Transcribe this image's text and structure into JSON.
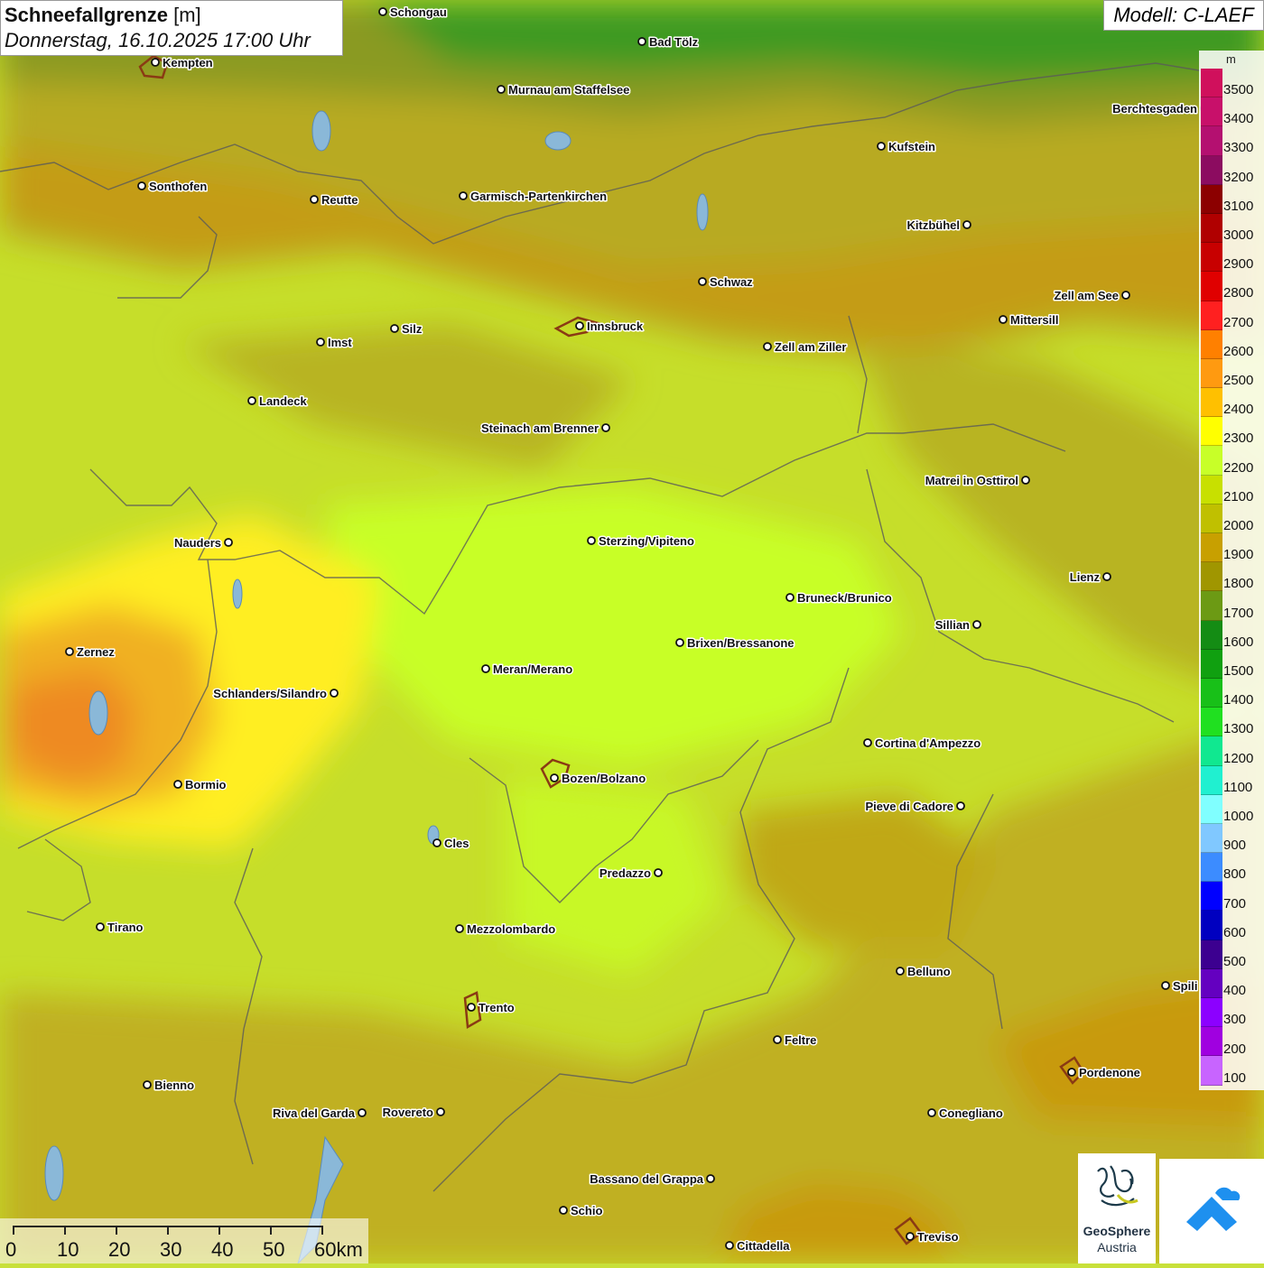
{
  "title": {
    "main": "Schneefallgrenze",
    "unit": "[m]",
    "date": "Donnerstag, 16.10.2025 17:00 Uhr"
  },
  "model": "Modell: C-LAEF",
  "legend": {
    "unit": "m",
    "labels": [
      "3500",
      "3400",
      "3300",
      "3200",
      "3100",
      "3000",
      "2900",
      "2800",
      "2700",
      "2600",
      "2500",
      "2400",
      "2300",
      "2200",
      "2100",
      "2000",
      "1900",
      "1800",
      "1700",
      "1600",
      "1500",
      "1400",
      "1300",
      "1200",
      "1100",
      "1000",
      "900",
      "800",
      "700",
      "600",
      "500",
      "400",
      "300",
      "200",
      "100"
    ],
    "colors": [
      "#d0105c",
      "#c8106a",
      "#b41070",
      "#8c0c60",
      "#8c0000",
      "#b00000",
      "#c80000",
      "#e00000",
      "#ff2020",
      "#ff8000",
      "#ff9a10",
      "#ffc000",
      "#ffff00",
      "#c8ff28",
      "#c8e000",
      "#c0c000",
      "#c8a000",
      "#a09600",
      "#6c9a14",
      "#148c14",
      "#10a010",
      "#18c018",
      "#20e020",
      "#10e890",
      "#20f0d0",
      "#80ffff",
      "#80c8ff",
      "#3c8cff",
      "#0000ff",
      "#0000c0",
      "#3c0090",
      "#6400c0",
      "#8c00ff",
      "#a000e0",
      "#c864ff"
    ]
  },
  "scale": {
    "labels": [
      "0",
      "10",
      "20",
      "30",
      "40",
      "50",
      "60km"
    ]
  },
  "logo": {
    "name": "GeoSphere",
    "sub": "Austria"
  },
  "cities": [
    {
      "name": "Schongau",
      "side": "right"
    },
    {
      "name": "Bad Tölz",
      "side": "right"
    },
    {
      "name": "Kempten",
      "side": "right"
    },
    {
      "name": "Murnau am Staffelsee",
      "side": "right"
    },
    {
      "name": "Berchtesgaden",
      "side": "left"
    },
    {
      "name": "Kufstein",
      "side": "right"
    },
    {
      "name": "Sonthofen",
      "side": "right"
    },
    {
      "name": "Reutte",
      "side": "right"
    },
    {
      "name": "Garmisch-Partenkirchen",
      "side": "right"
    },
    {
      "name": "Kitzbühel",
      "side": "left"
    },
    {
      "name": "Schwaz",
      "side": "right"
    },
    {
      "name": "Zell am See",
      "side": "left"
    },
    {
      "name": "Mittersill",
      "side": "right"
    },
    {
      "name": "Innsbruck",
      "side": "right"
    },
    {
      "name": "Imst",
      "side": "right"
    },
    {
      "name": "Silz",
      "side": "right"
    },
    {
      "name": "Zell am Ziller",
      "side": "right"
    },
    {
      "name": "Landeck",
      "side": "right"
    },
    {
      "name": "Steinach am Brenner",
      "side": "left"
    },
    {
      "name": "Matrei in Osttirol",
      "side": "left"
    },
    {
      "name": "Nauders",
      "side": "left"
    },
    {
      "name": "Sterzing/Vipiteno",
      "side": "right"
    },
    {
      "name": "Lienz",
      "side": "left"
    },
    {
      "name": "Bruneck/Brunico",
      "side": "right"
    },
    {
      "name": "Sillian",
      "side": "left"
    },
    {
      "name": "Zernez",
      "side": "right"
    },
    {
      "name": "Brixen/Bressanone",
      "side": "right"
    },
    {
      "name": "Meran/Merano",
      "side": "right"
    },
    {
      "name": "Schlanders/Silandro",
      "side": "left"
    },
    {
      "name": "Cortina d'Ampezzo",
      "side": "right"
    },
    {
      "name": "Bozen/Bolzano",
      "side": "right"
    },
    {
      "name": "Bormio",
      "side": "right"
    },
    {
      "name": "Pieve di Cadore",
      "side": "left"
    },
    {
      "name": "Cles",
      "side": "right"
    },
    {
      "name": "Predazzo",
      "side": "left"
    },
    {
      "name": "Tirano",
      "side": "right"
    },
    {
      "name": "Mezzolombardo",
      "side": "right"
    },
    {
      "name": "Belluno",
      "side": "right"
    },
    {
      "name": "Spili",
      "side": "right"
    },
    {
      "name": "Trento",
      "side": "right"
    },
    {
      "name": "Feltre",
      "side": "right"
    },
    {
      "name": "Pordenone",
      "side": "right"
    },
    {
      "name": "Bienno",
      "side": "right"
    },
    {
      "name": "Riva del Garda",
      "side": "left"
    },
    {
      "name": "Rovereto",
      "side": "left"
    },
    {
      "name": "Conegliano",
      "side": "right"
    },
    {
      "name": "Bassano del Grappa",
      "side": "left"
    },
    {
      "name": "Schio",
      "side": "right"
    },
    {
      "name": "Treviso",
      "side": "right"
    },
    {
      "name": "Cittadella",
      "side": "right"
    }
  ]
}
